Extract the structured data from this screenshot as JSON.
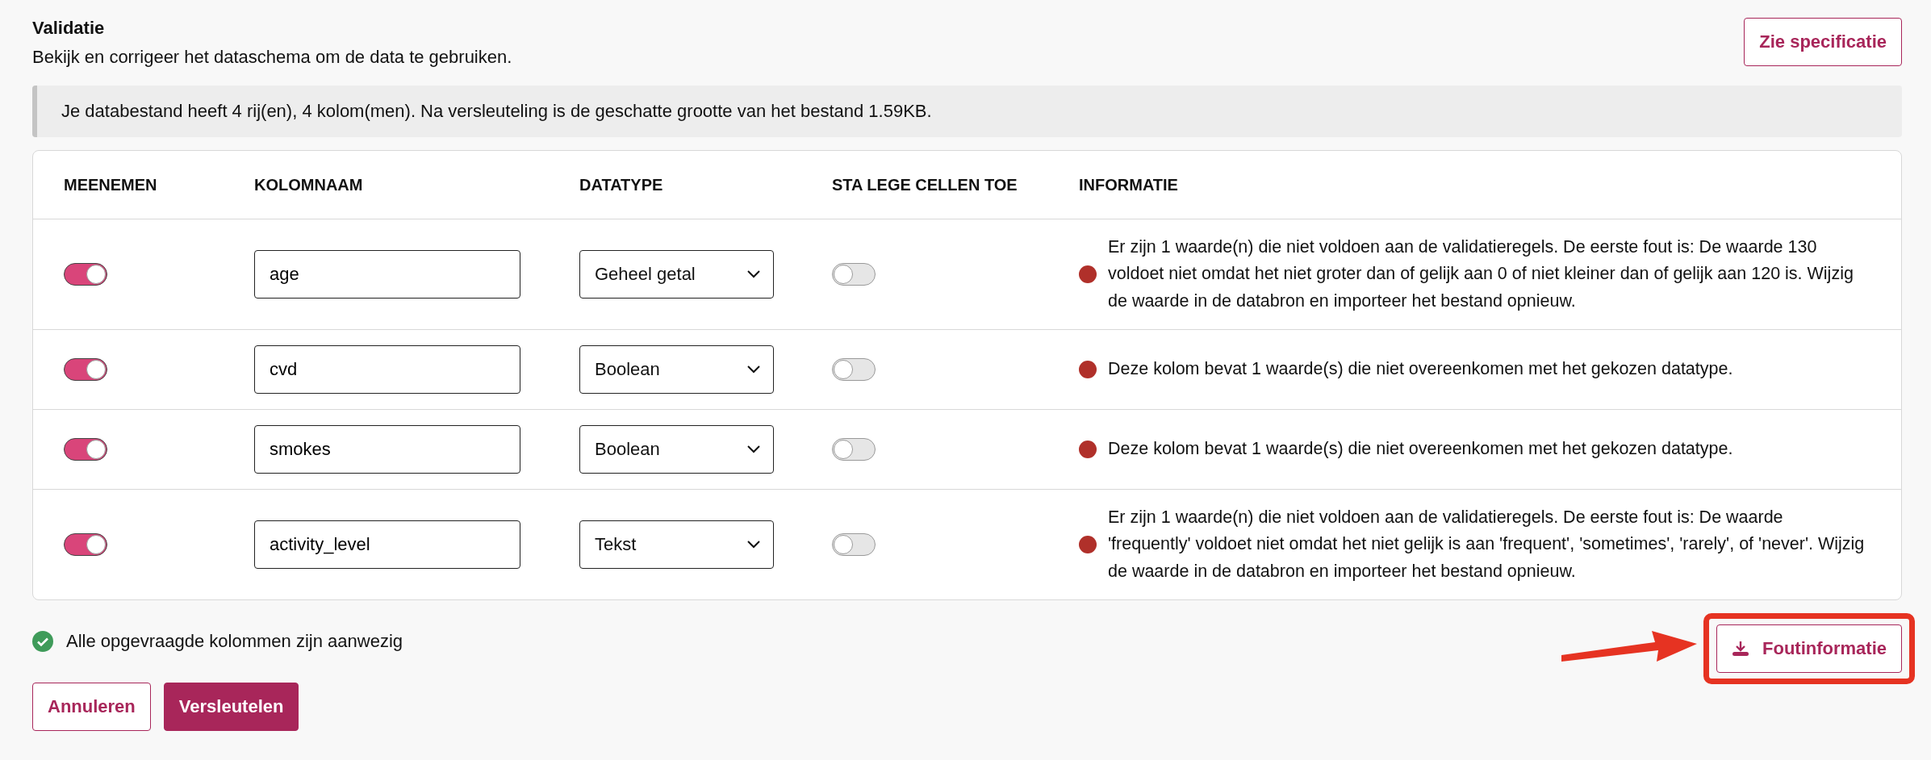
{
  "header": {
    "title": "Validatie",
    "subtitle": "Bekijk en corrigeer het dataschema om de data te gebruiken.",
    "spec_button": "Zie specificatie"
  },
  "notice": "Je databestand heeft 4 rij(en), 4 kolom(men). Na versleuteling is de geschatte grootte van het bestand 1.59KB.",
  "table": {
    "columns": [
      "MEENEMEN",
      "KOLOMNAAM",
      "DATATYPE",
      "STA LEGE CELLEN TOE",
      "INFORMATIE"
    ],
    "rows": [
      {
        "include": true,
        "name": "age",
        "datatype": "Geheel getal",
        "allow_empty": false,
        "valid": false,
        "info": "Er zijn 1 waarde(n) die niet voldoen aan de validatieregels. De eerste fout is: De waarde 130 voldoet niet omdat het niet groter dan of gelijk aan 0 of niet kleiner dan of gelijk aan 120 is. Wijzig de waarde in de databron en importeer het bestand opnieuw."
      },
      {
        "include": true,
        "name": "cvd",
        "datatype": "Boolean",
        "allow_empty": false,
        "valid": false,
        "info": "Deze kolom bevat 1 waarde(s) die niet overeenkomen met het gekozen datatype."
      },
      {
        "include": true,
        "name": "smokes",
        "datatype": "Boolean",
        "allow_empty": false,
        "valid": false,
        "info": "Deze kolom bevat 1 waarde(s) die niet overeenkomen met het gekozen datatype."
      },
      {
        "include": true,
        "name": "activity_level",
        "datatype": "Tekst",
        "allow_empty": false,
        "valid": false,
        "info": "Er zijn 1 waarde(n) die niet voldoen aan de validatieregels. De eerste fout is: De waarde 'frequently' voldoet niet omdat het niet gelijk is aan 'frequent', 'sometimes', 'rarely', of 'never'. Wijzig de waarde in de databron en importeer het bestand opnieuw."
      }
    ]
  },
  "columns_check": {
    "all_present": true,
    "text": "Alle opgevraagde kolommen zijn aanwezig"
  },
  "error_info_button": "Foutinformatie",
  "buttons": {
    "cancel": "Annuleren",
    "encrypt": "Versleutelen"
  }
}
